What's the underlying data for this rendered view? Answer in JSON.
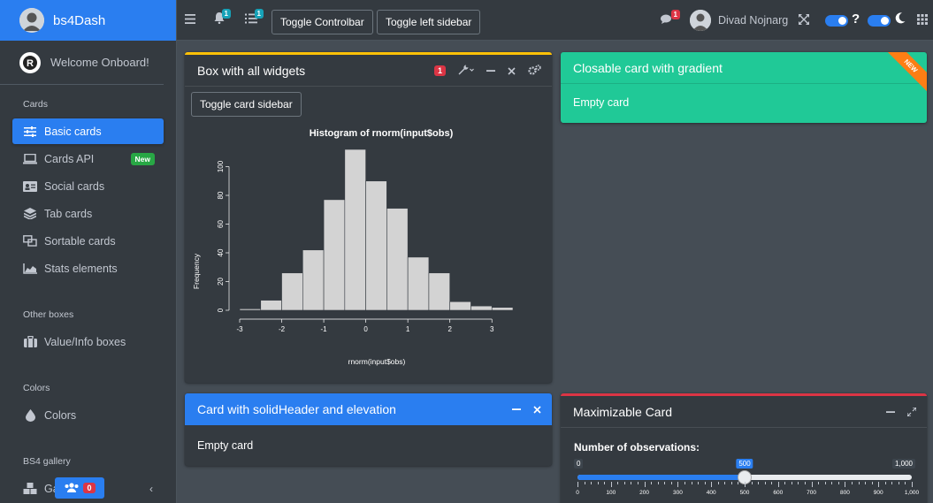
{
  "brand": {
    "title": "bs4Dash"
  },
  "sidebar": {
    "welcome": "Welcome Onboard!",
    "sections": {
      "cards": "Cards",
      "other": "Other boxes",
      "colors": "Colors",
      "gallery": "BS4 gallery"
    },
    "items": [
      {
        "label": "Basic cards",
        "icon": "sliders-icon",
        "active": true
      },
      {
        "label": "Cards API",
        "icon": "laptop-icon",
        "badge": "New"
      },
      {
        "label": "Social cards",
        "icon": "id-card-icon"
      },
      {
        "label": "Tab cards",
        "icon": "layer-group-icon"
      },
      {
        "label": "Sortable cards",
        "icon": "object-ungroup-icon"
      },
      {
        "label": "Stats elements",
        "icon": "chart-area-icon"
      },
      {
        "label": "Value/Info boxes",
        "icon": "suitcase-icon"
      },
      {
        "label": "Colors",
        "icon": "tint-icon"
      },
      {
        "label": "Galleries",
        "icon": "cubes-icon"
      }
    ],
    "footer_badge": "0"
  },
  "navbar": {
    "notif_badge": "1",
    "tasks_badge": "1",
    "toggle_controlbar": "Toggle Controlbar",
    "toggle_left_sidebar": "Toggle left sidebar",
    "messages_badge": "1",
    "user_name": "Divad Nojnarg"
  },
  "cards": {
    "widgets": {
      "title": "Box with all widgets",
      "label_badge": "1",
      "button": "Toggle card sidebar"
    },
    "gradient": {
      "title": "Closable card with gradient",
      "ribbon": "NEW",
      "body": "Empty card"
    },
    "solid": {
      "title": "Card with solidHeader and elevation",
      "body": "Empty card"
    },
    "maximizable": {
      "title": "Maximizable Card",
      "slider_label": "Number of observations:",
      "slider_min": "0",
      "slider_value": "500",
      "slider_max": "1,000",
      "slider_fraction": 0.5,
      "ticks": [
        "0",
        "100",
        "200",
        "300",
        "400",
        "500",
        "600",
        "700",
        "800",
        "900",
        "1,000"
      ]
    }
  },
  "colors": {
    "primary": "#2a7ef0",
    "sidebar_bg": "#343a40",
    "content_bg": "#454d55",
    "gradient": "#20c997",
    "danger": "#dc3545",
    "success": "#28a745",
    "warning": "#ffc107"
  },
  "chart_data": {
    "type": "bar",
    "title": "Histogram of rnorm(input$obs)",
    "xlabel": "rnorm(input$obs)",
    "ylabel": "Frequency",
    "bin_edges": [
      -3.0,
      -2.5,
      -2.0,
      -1.5,
      -1.0,
      -0.5,
      0.0,
      0.5,
      1.0,
      1.5,
      2.0,
      2.5,
      3.0,
      3.5
    ],
    "values": [
      1,
      7,
      26,
      42,
      77,
      112,
      90,
      71,
      37,
      26,
      6,
      3,
      2
    ],
    "x_ticks": [
      "-3",
      "-2",
      "-1",
      "0",
      "1",
      "2",
      "3"
    ],
    "y_ticks": [
      "0",
      "20",
      "40",
      "60",
      "80",
      "100"
    ],
    "xlim": [
      -3.0,
      3.5
    ],
    "ylim": [
      0,
      112
    ],
    "grid": false
  }
}
